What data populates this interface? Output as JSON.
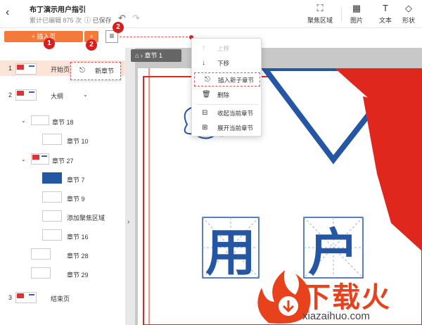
{
  "header": {
    "title": "布丁演示用户指引",
    "meta": "累计已编辑 875 次",
    "save_state": "已保存",
    "tools": [
      {
        "label": "聚焦区域",
        "icon": "focus-icon"
      },
      {
        "label": "图片",
        "icon": "image-icon"
      },
      {
        "label": "文本",
        "icon": "text-icon"
      },
      {
        "label": "形状",
        "icon": "shape-icon"
      }
    ]
  },
  "toolbar": {
    "add_page": "+ 插入页",
    "add_more": "+"
  },
  "badges": [
    "1",
    "2",
    "2"
  ],
  "popup": {
    "new_chapter": "新章节"
  },
  "breadcrumb": {
    "label": "章节 1"
  },
  "sidebar": {
    "items": [
      {
        "num": "1",
        "label": "开始页",
        "selected": true
      },
      {
        "num": "2",
        "label": "大纲"
      },
      {
        "label": "章节 18"
      },
      {
        "label": "章节 10"
      },
      {
        "label": "章节 27"
      },
      {
        "label": "章节 7"
      },
      {
        "label": "章节 9"
      },
      {
        "label": "添加聚焦区域"
      },
      {
        "label": "章节 16"
      },
      {
        "label": "章节 28"
      },
      {
        "label": "章节 29"
      },
      {
        "num": "3",
        "label": "结束页"
      }
    ]
  },
  "context_menu": {
    "items": [
      {
        "label": "上移",
        "disabled": true
      },
      {
        "label": "下移"
      },
      {
        "label": "插入新子章节",
        "highlighted": true
      },
      {
        "label": "删除"
      },
      {
        "label": "收起当前章节"
      },
      {
        "label": "展开当前章节"
      }
    ]
  },
  "slide": {
    "chars": [
      "用",
      "户"
    ]
  },
  "watermark": {
    "text": "下载火",
    "url": "xiazaihuo.com"
  },
  "colors": {
    "accent": "#f47a3c",
    "annotation": "#d81e1e",
    "slide_blue": "#2456a4",
    "slide_red": "#e0271d"
  }
}
